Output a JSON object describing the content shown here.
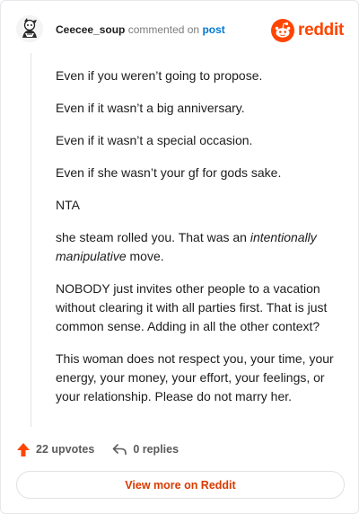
{
  "header": {
    "username": "Ceecee_soup",
    "action_text": "commented on",
    "post_link": "post",
    "brand_name": "reddit",
    "brand_color": "#ff4500"
  },
  "comment": {
    "p1": "Even if you weren’t going to propose.",
    "p2": "Even if it wasn’t a big anniversary.",
    "p3": "Even if it wasn’t a special occasion.",
    "p4": "Even if she wasn’t your gf for gods sake.",
    "p5": "NTA",
    "p6_a": "she steam rolled you. That was an ",
    "p6_em": "intentionally manipulative",
    "p6_b": " move.",
    "p7": "NOBODY just invites other people to a vacation without clearing it with all parties first. That is just common sense. Adding in all the other context?",
    "p8": "This woman does not respect you, your time, your energy, your money, your effort, your feelings, or your relationship. Please do not marry her."
  },
  "actions": {
    "upvotes": "22 upvotes",
    "replies": "0 replies"
  },
  "footer": {
    "view_more": "View more on Reddit"
  },
  "icons": {
    "avatar": "user-avatar",
    "brand": "reddit-snoo-icon",
    "upvote": "upvote-arrow-icon",
    "reply": "reply-arrow-icon"
  },
  "colors": {
    "link": "#0079d3",
    "upvote": "#ff4500",
    "view_more_text": "#d93a00"
  }
}
